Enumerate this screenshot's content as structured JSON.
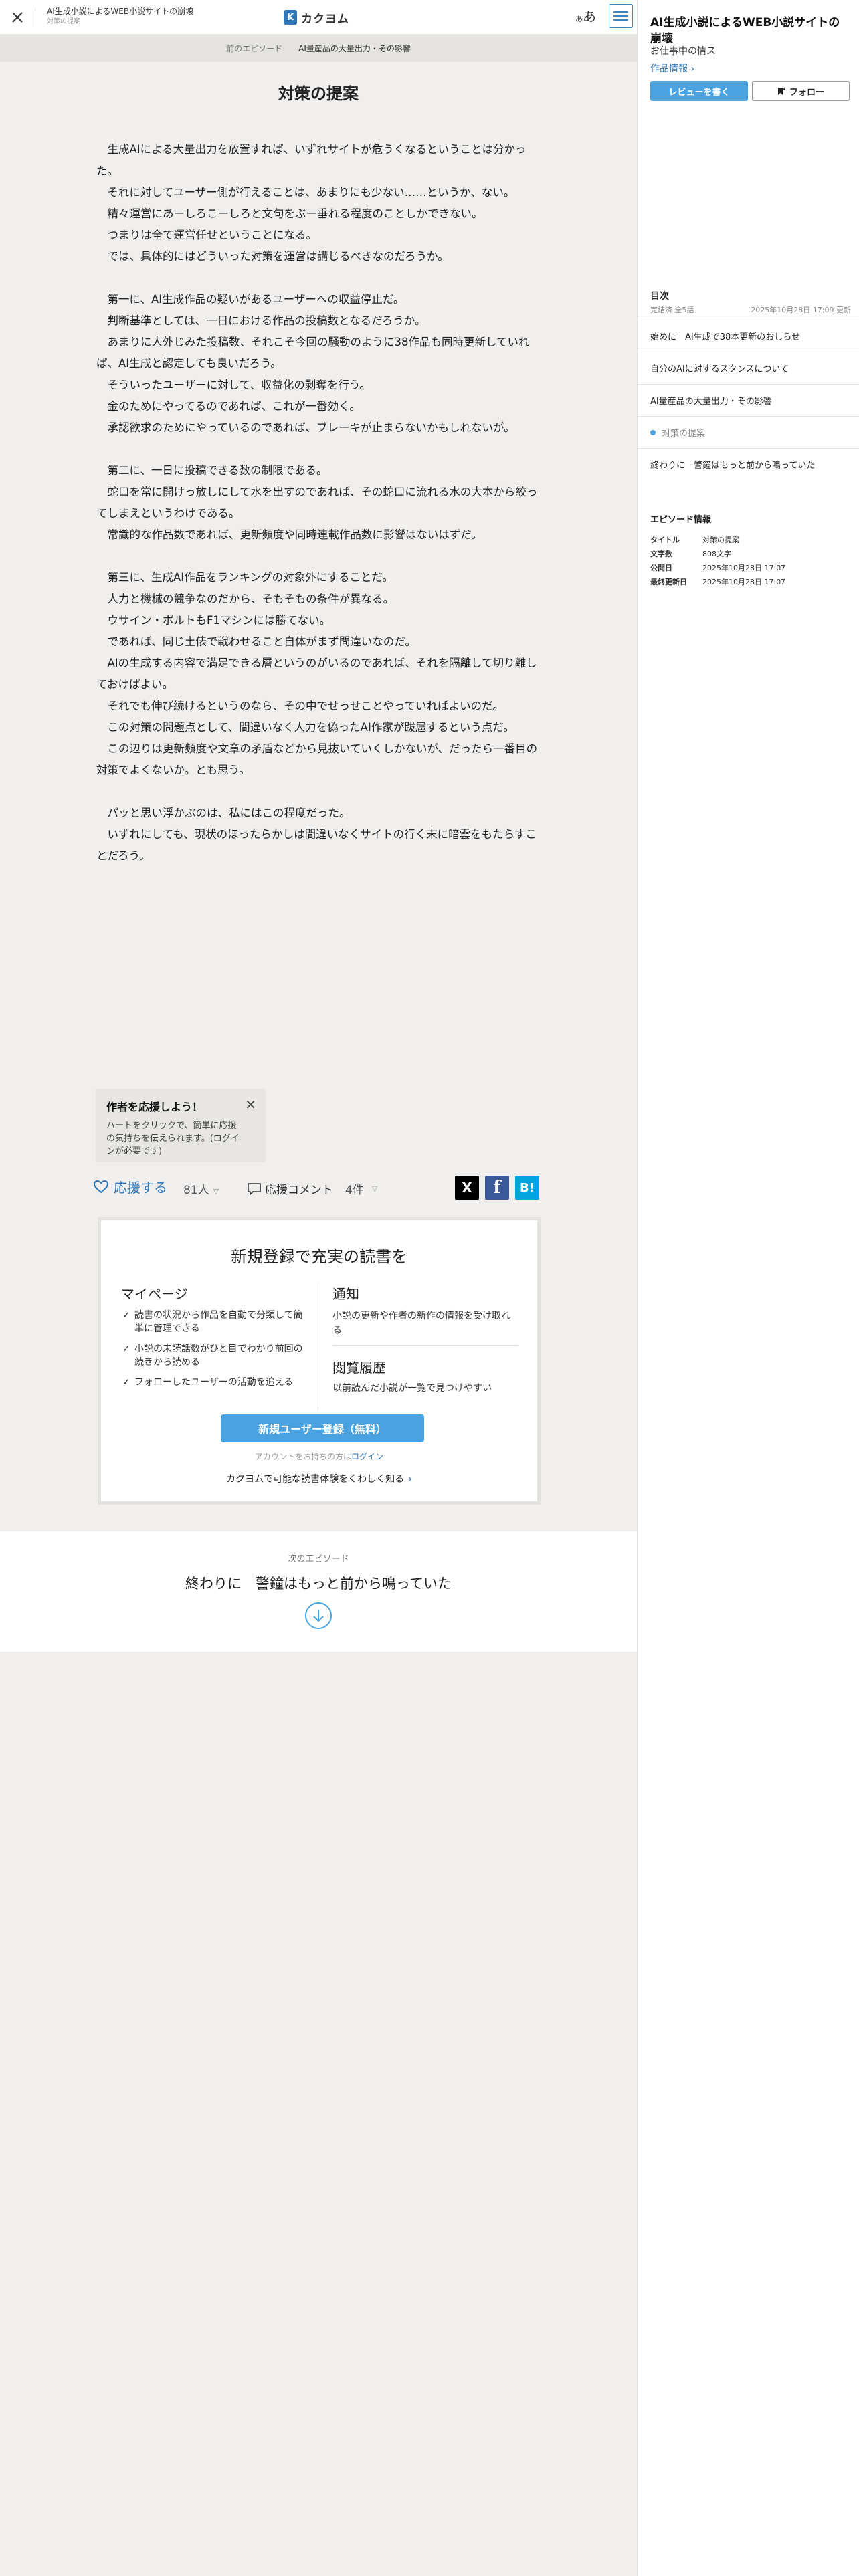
{
  "header": {
    "work_title": "AI生成小説によるWEB小説サイトの崩壊",
    "episode_title": "対策の提案",
    "logo_text": "カクヨム",
    "font_button_small": "あ",
    "font_button_large": "あ"
  },
  "episode_nav": {
    "prev_label": "前のエピソード",
    "prev_title": "AI量産品の大量出力・その影響"
  },
  "episode": {
    "title": "対策の提案",
    "paragraphs": [
      "　生成AIによる大量出力を放置すれば、いずれサイトが危うくなるということは分かった。",
      "　それに対してユーザー側が行えることは、あまりにも少ない……というか、ない。",
      "　精々運営にあーしろこーしろと文句をぶー垂れる程度のことしかできない。",
      "　つまりは全て運営任せということになる。",
      "　では、具体的にはどういった対策を運営は講じるべきなのだろうか。",
      "",
      "　第一に、AI生成作品の疑いがあるユーザーへの収益停止だ。",
      "　判断基準としては、一日における作品の投稿数となるだろうか。",
      "　あまりに人外じみた投稿数、それこそ今回の騒動のように38作品も同時更新していれば、AI生成と認定しても良いだろう。",
      "　そういったユーザーに対して、収益化の剥奪を行う。",
      "　金のためにやってるのであれば、これが一番効く。",
      "　承認欲求のためにやっているのであれば、ブレーキが止まらないかもしれないが。",
      "",
      "　第二に、一日に投稿できる数の制限である。",
      "　蛇口を常に開けっ放しにして水を出すのであれば、その蛇口に流れる水の大本から絞ってしまえというわけである。",
      "　常識的な作品数であれば、更新頻度や同時連載作品数に影響はないはずだ。",
      "",
      "　第三に、生成AI作品をランキングの対象外にすることだ。",
      "　人力と機械の競争なのだから、そもそもの条件が異なる。",
      "　ウサイン・ボルトもF1マシンには勝てない。",
      "　であれば、同じ土俵で戦わせること自体がまず間違いなのだ。",
      "　AIの生成する内容で満足できる層というのがいるのであれば、それを隔離して切り離しておけばよい。",
      "　それでも伸び続けるというのなら、その中でせっせことやっていればよいのだ。",
      "　この対策の問題点として、間違いなく人力を偽ったAI作家が跋扈するという点だ。",
      "　この辺りは更新頻度や文章の矛盾などから見抜いていくしかないが、だったら一番目の対策でよくないか。とも思う。",
      "",
      "　パッと思い浮かぶのは、私にはこの程度だった。",
      "　いずれにしても、現状のほったらかしは間違いなくサイトの行く末に暗雲をもたらすことだろう。"
    ]
  },
  "tip": {
    "title": "作者を応援しよう！",
    "body": "ハートをクリックで、簡単に応援の気持ちを伝えられます。(ログインが必要です)"
  },
  "actions": {
    "cheer_label": "応援する",
    "cheer_count": "81人",
    "comment_label": "応援コメント",
    "comment_count": "4件",
    "share_x": "X",
    "share_facebook": "f",
    "share_hatena": "B!"
  },
  "signup": {
    "title": "新規登録で充実の読書を",
    "mypage_title": "マイページ",
    "mypage_items": [
      "読書の状況から作品を自動で分類して簡単に管理できる",
      "小説の未読話数がひと目でわかり前回の続きから読める",
      "フォローしたユーザーの活動を追える"
    ],
    "notify_title": "通知",
    "notify_desc": "小説の更新や作者の新作の情報を受け取れる",
    "history_title": "閲覧履歴",
    "history_desc": "以前読んだ小説が一覧で見つけやすい",
    "register_label": "新規ユーザー登録（無料）",
    "login_prefix": "アカウントをお持ちの方は",
    "login_link": "ログイン",
    "learn_more": "カクヨムで可能な読書体験をくわしく知る"
  },
  "next": {
    "label": "次のエピソード",
    "title": "終わりに　警鐘はもっと前から鳴っていた"
  },
  "sidebar": {
    "work_title": "AI生成小説によるWEB小説サイトの崩壊",
    "author": "お仕事中の情ス",
    "work_link": "作品情報",
    "review_button": "レビューを書く",
    "follow_button": "フォロー",
    "toc_heading": "目次",
    "toc_status": "完結済 全5話",
    "toc_updated": "2025年10月28日 17:09 更新",
    "toc_items": [
      {
        "label": "始めに　AI生成で38本更新のおしらせ",
        "current": false
      },
      {
        "label": "自分のAIに対するスタンスについて",
        "current": false
      },
      {
        "label": "AI量産品の大量出力・その影響",
        "current": false
      },
      {
        "label": "対策の提案",
        "current": true
      },
      {
        "label": "終わりに　警鐘はもっと前から鳴っていた",
        "current": false
      }
    ],
    "ep_info_heading": "エピソード情報",
    "ep_info": [
      {
        "key": "タイトル",
        "value": "対策の提案"
      },
      {
        "key": "文字数",
        "value": "808文字"
      },
      {
        "key": "公開日",
        "value": "2025年10月28日 17:07"
      },
      {
        "key": "最終更新日",
        "value": "2025年10月28日 17:07"
      }
    ]
  },
  "colors": {
    "accent": "#2f76b8",
    "button_blue": "#4aa3e0",
    "page_bg": "#f0efed"
  }
}
